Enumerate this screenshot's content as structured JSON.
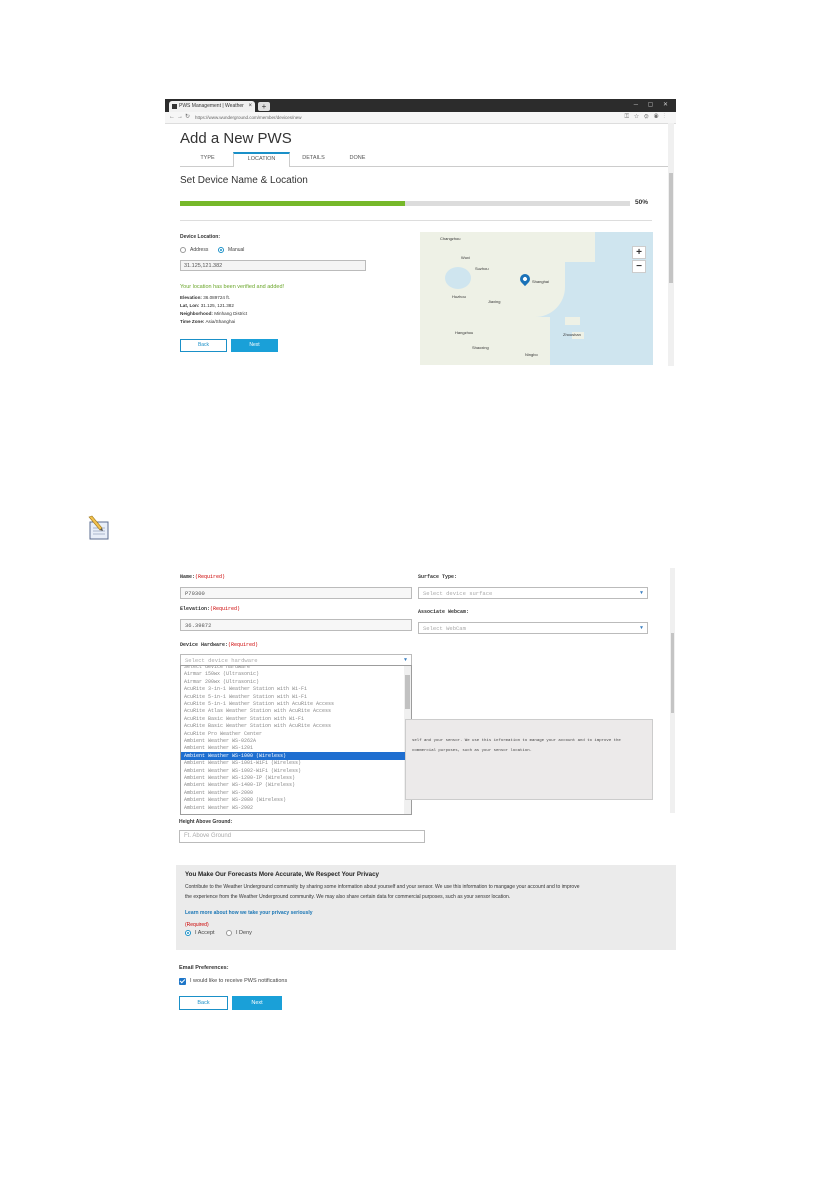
{
  "shot1": {
    "browser": {
      "tab_title": "PWS Management | Weather",
      "tab_close": "×",
      "new_tab": "+",
      "url": "https://www.wunderground.com/member/devices/new"
    },
    "page_title": "Add a New PWS",
    "steps": [
      "TYPE",
      "LOCATION",
      "DETAILS",
      "DONE"
    ],
    "active_step": "LOCATION",
    "subtitle": "Set Device Name & Location",
    "progress": {
      "value": 0.5,
      "label": "50%"
    },
    "device_location_label": "Device Location:",
    "location_modes": [
      "Address",
      "Manual"
    ],
    "selected_mode": "Manual",
    "coordinates": "31.125,121.382",
    "verified_text": "Your location has been verified and added!",
    "info": [
      {
        "label": "Elevation:",
        "value": "36.089724 ft."
      },
      {
        "label": "Lat, Lon:",
        "value": "31.125, 121.382"
      },
      {
        "label": "Neighborhood:",
        "value": "Minhang District"
      },
      {
        "label": "Time Zone:",
        "value": "Asia/Shanghai"
      }
    ],
    "back_label": "Back",
    "next_label": "Next",
    "map": {
      "zoom_in": "+",
      "zoom_out": "−",
      "places": [
        "Changzhou",
        "Wuxi",
        "Suzhou",
        "Shanghai",
        "Huzhou",
        "Jiaxing",
        "Hangzhou",
        "Shaoxing",
        "Ningbo",
        "Zhoushan"
      ]
    }
  },
  "note_icon": "note-pencil-icon",
  "shot2": {
    "name_label": "Name:",
    "required": "(Required)",
    "name_value": "P70300",
    "elevation_label": "Elevation:",
    "elevation_value": "36.39872",
    "hardware_label": "Device Hardware:",
    "hardware_placeholder": "Select device hardware",
    "surface_label": "Surface Type:",
    "surface_placeholder": "Select device surface",
    "webcam_label": "Associate Webcam:",
    "webcam_placeholder": "Select WebCam",
    "hardware_options": [
      "Select device hardware",
      "Airmar 150wx (Ultrasonic)",
      "Airmar 200wx (Ultrasonic)",
      "AcuRite 3-in-1 Weather Station with Wi-Fi",
      "AcuRite 5-in-1 Weather Station with Wi-Fi",
      "AcuRite 5-in-1 Weather Station with AcuRite Access",
      "AcuRite Atlas Weather Station with AcuRite Access",
      "AcuRite Basic Weather Station with Wi-Fi",
      "AcuRite Basic Weather Station with AcuRite Access",
      "AcuRite Pro Weather Center",
      "Ambient Weather WS-0262A",
      "Ambient Weather WS-1201",
      "Ambient Weather WS-1000 (Wireless)",
      "Ambient Weather WS-1001-WiFi (Wireless)",
      "Ambient Weather WS-1002-WiFi (Wireless)",
      "Ambient Weather WS-1200-IP (Wireless)",
      "Ambient Weather WS-1400-IP (Wireless)",
      "Ambient Weather WS-2000",
      "Ambient Weather WS-2080 (Wireless)",
      "Ambient Weather WS-2902"
    ],
    "selected_option_index": 12,
    "gray_text": [
      "self and your sensor. We use this information to manage your account and to improve the",
      "commercial purposes, such as your sensor location."
    ],
    "height_label": "Height Above Ground:",
    "height_placeholder": "Ft. Above Ground",
    "privacy_title": "You Make Our Forecasts More Accurate, We Respect Your Privacy",
    "privacy_text": [
      "Contribute to the Weather Underground community by sharing some information about yourself and your sensor. We use this information to mangage your account and to improve",
      "the experience from the Weather Underground community. We may also share certain data for commercial purposes, such as your sensor location."
    ],
    "privacy_link": "Learn more about how we take your privacy seriously",
    "accept_label": "I Accept",
    "deny_label": "I Deny",
    "consent": "I Accept",
    "email_label": "Email Preferences:",
    "email_checkbox_label": "I would like to receive PWS notifications",
    "email_checked": true,
    "back_label": "Back",
    "next_label": "Next"
  }
}
